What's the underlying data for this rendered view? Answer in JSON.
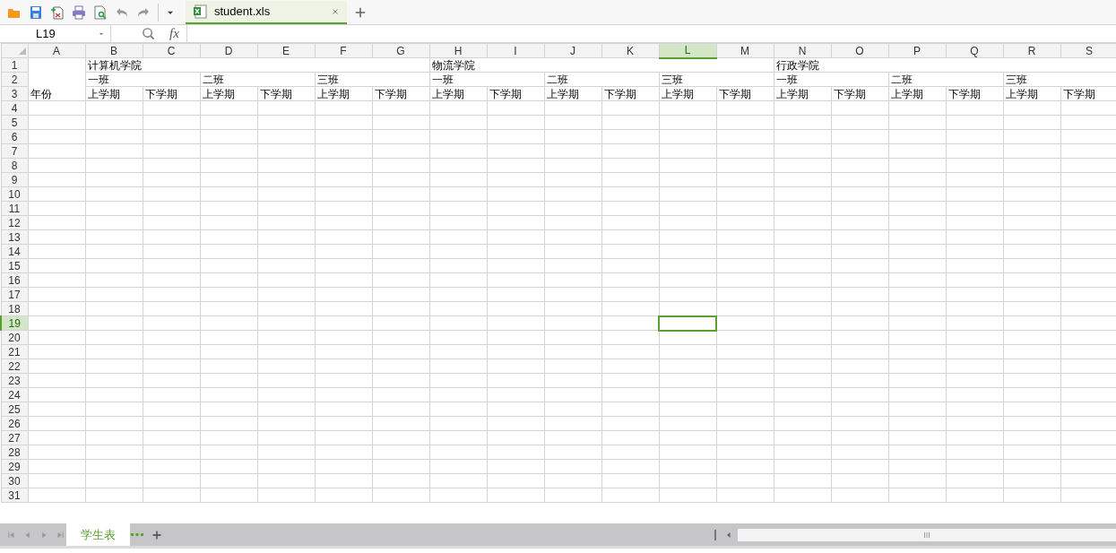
{
  "document_tab": {
    "label": "student.xls"
  },
  "name_box": {
    "value": "L19"
  },
  "formula_bar": {
    "value_icon": "fx"
  },
  "columns": [
    {
      "label": "A",
      "selected": false
    },
    {
      "label": "B",
      "selected": false
    },
    {
      "label": "C",
      "selected": false
    },
    {
      "label": "D",
      "selected": false
    },
    {
      "label": "E",
      "selected": false
    },
    {
      "label": "F",
      "selected": false
    },
    {
      "label": "G",
      "selected": false
    },
    {
      "label": "H",
      "selected": false
    },
    {
      "label": "I",
      "selected": false
    },
    {
      "label": "J",
      "selected": false
    },
    {
      "label": "K",
      "selected": false
    },
    {
      "label": "L",
      "selected": true
    },
    {
      "label": "M",
      "selected": false
    },
    {
      "label": "N",
      "selected": false
    },
    {
      "label": "O",
      "selected": false
    },
    {
      "label": "P",
      "selected": false
    },
    {
      "label": "Q",
      "selected": false
    },
    {
      "label": "R",
      "selected": false
    },
    {
      "label": "S",
      "selected": false
    }
  ],
  "row_label": "年份",
  "colleges": [
    {
      "name": "计算机学院",
      "classes": [
        {
          "name": "一班",
          "terms": [
            "上学期",
            "下学期"
          ]
        },
        {
          "name": "二班",
          "terms": [
            "上学期",
            "下学期"
          ]
        },
        {
          "name": "三班",
          "terms": [
            "上学期",
            "下学期"
          ]
        }
      ]
    },
    {
      "name": "物流学院",
      "classes": [
        {
          "name": "一班",
          "terms": [
            "上学期",
            "下学期"
          ]
        },
        {
          "name": "二班",
          "terms": [
            "上学期",
            "下学期"
          ]
        },
        {
          "name": "三班",
          "terms": [
            "上学期",
            "下学期"
          ]
        }
      ]
    },
    {
      "name": "行政学院",
      "classes": [
        {
          "name": "一班",
          "terms": [
            "上学期",
            "下学期"
          ]
        },
        {
          "name": "二班",
          "terms": [
            "上学期",
            "下学期"
          ]
        },
        {
          "name": "三班",
          "terms": [
            "上学期",
            "下学期"
          ]
        }
      ]
    }
  ],
  "rows": [
    {
      "label": "1",
      "selected": false
    },
    {
      "label": "2",
      "selected": false
    },
    {
      "label": "3",
      "selected": false
    },
    {
      "label": "4",
      "selected": false
    },
    {
      "label": "5",
      "selected": false
    },
    {
      "label": "6",
      "selected": false
    },
    {
      "label": "7",
      "selected": false
    },
    {
      "label": "8",
      "selected": false
    },
    {
      "label": "9",
      "selected": false
    },
    {
      "label": "10",
      "selected": false
    },
    {
      "label": "11",
      "selected": false
    },
    {
      "label": "12",
      "selected": false
    },
    {
      "label": "13",
      "selected": false
    },
    {
      "label": "14",
      "selected": false
    },
    {
      "label": "15",
      "selected": false
    },
    {
      "label": "16",
      "selected": false
    },
    {
      "label": "17",
      "selected": false
    },
    {
      "label": "18",
      "selected": false
    },
    {
      "label": "19",
      "selected": true
    },
    {
      "label": "20",
      "selected": false
    },
    {
      "label": "21",
      "selected": false
    },
    {
      "label": "22",
      "selected": false
    },
    {
      "label": "23",
      "selected": false
    },
    {
      "label": "24",
      "selected": false
    },
    {
      "label": "25",
      "selected": false
    },
    {
      "label": "26",
      "selected": false
    },
    {
      "label": "27",
      "selected": false
    },
    {
      "label": "28",
      "selected": false
    },
    {
      "label": "29",
      "selected": false
    },
    {
      "label": "30",
      "selected": false
    },
    {
      "label": "31",
      "selected": false
    }
  ],
  "sheet_tabs": [
    {
      "label": "学生表",
      "selected": true
    }
  ]
}
